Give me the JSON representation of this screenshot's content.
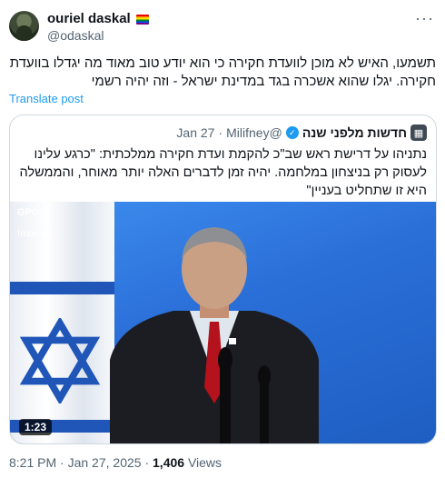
{
  "author": {
    "display_name": "ouriel daskal",
    "handle": "@odaskal"
  },
  "post": {
    "text": "תשמעו, האיש לא מוכן לוועדת חקירה כי הוא יודע טוב מאוד מה יגדלו בוועדת חקירה. יגלו שהוא אשכרה בגד במדינת ישראל - וזה יהיה רשמי",
    "translate_label": "Translate post"
  },
  "quote": {
    "name": "חדשות מלפני שנה",
    "handle": "@Milifney",
    "dot": "·",
    "date": "Jan 27",
    "text": "נתניהו על דרישת ראש שב\"כ להקמת ועדת חקירה ממלכתית: \"כרגע עלינו לעסוק רק בניצחון במלחמה. יהיה זמן לדברים האלה יותר מאוחר, והממשלה היא זו שתחליט בעניין\"",
    "video": {
      "watermark": "GPO",
      "watermark_sub": "יחד ננצח!",
      "duration": "1:23"
    }
  },
  "meta": {
    "time": "8:21 PM",
    "dot": "·",
    "date": "Jan 27, 2025",
    "dot2": "·",
    "views": "1,406",
    "views_label": "Views"
  },
  "icons": {
    "more": "more-icon",
    "verified": "verified-badge-icon",
    "flag": "rainbow-flag-icon"
  },
  "colors": {
    "link": "#1d9bf0",
    "muted": "#536471",
    "video_bg": "#2a6fd8"
  }
}
